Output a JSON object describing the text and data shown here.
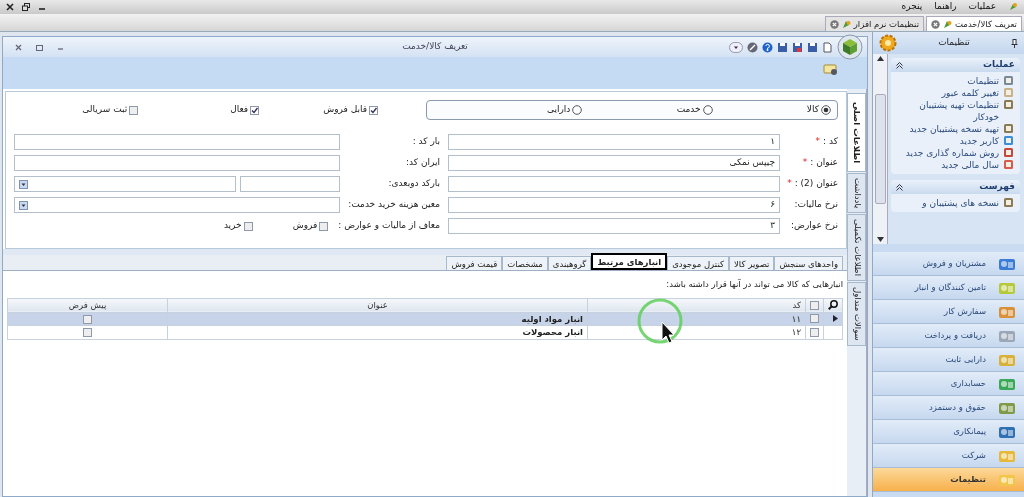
{
  "menu_bar": {
    "items": [
      "عملیات",
      "راهنما",
      "پنجره"
    ]
  },
  "document_tabs": [
    {
      "label": "تعریف کالا/خدمت",
      "selected": true
    },
    {
      "label": "تنظیمات نرم افزار",
      "selected": false
    }
  ],
  "window": {
    "title": "تعریف کالا/خدمت"
  },
  "side_tabs": [
    {
      "label": "اطلاعات اصلی",
      "selected": true
    },
    {
      "label": "یادداشت",
      "selected": false
    },
    {
      "label": "اطلاعات تکمیلی",
      "selected": false
    },
    {
      "label": "سوالات متداول",
      "selected": false
    }
  ],
  "item_type": [
    {
      "label": "کالا",
      "selected": true
    },
    {
      "label": "خدمت",
      "selected": false
    },
    {
      "label": "دارایی",
      "selected": false
    }
  ],
  "flags": [
    {
      "label": "قابل فروش",
      "checked": true
    },
    {
      "label": "فعال",
      "checked": true
    },
    {
      "label": "ثبت سریالی",
      "checked": false
    }
  ],
  "fields_right": [
    {
      "label": "کد :",
      "required_mark": "*",
      "value": "۱"
    },
    {
      "label": "عنوان :",
      "required_mark": "*",
      "value": "چیپس نمکی"
    },
    {
      "label": "عنوان (2) :",
      "required_mark": "*"
    },
    {
      "label": "نرخ مالیات:",
      "value": "۶"
    },
    {
      "label": "نرخ عوارض:",
      "value": "۳"
    }
  ],
  "fields_left": [
    {
      "label": "بار کد :",
      "kind": "text"
    },
    {
      "label": "ایران کد:",
      "kind": "text"
    },
    {
      "label": "بارکد دوبعدی:",
      "kind": "split"
    },
    {
      "label": "معین هزینه خرید خدمت:",
      "kind": "dropdown"
    }
  ],
  "exemption": {
    "label": "معاف از مالیات و عوارض :",
    "options": [
      {
        "label": "فروش",
        "checked": false
      },
      {
        "label": "خرید",
        "checked": false
      }
    ]
  },
  "detail_tabs": [
    {
      "label": "واحدهای سنجش",
      "selected": false
    },
    {
      "label": "تصویر کالا",
      "selected": false
    },
    {
      "label": "کنترل موجودی",
      "selected": false
    },
    {
      "label": "انبارهای مرتبط",
      "selected": true
    },
    {
      "label": "گروهبندی",
      "selected": false
    },
    {
      "label": "مشخصات",
      "selected": false
    },
    {
      "label": "قیمت فروش",
      "selected": false
    }
  ],
  "warehouses": {
    "caption": "انبارهایی که کالا می تواند در آنها قرار داشته باشد:",
    "select_all": false,
    "columns": [
      "کد",
      "عنوان",
      "پیش فرض"
    ],
    "rows": [
      {
        "code": "۱۱",
        "title": "انبار مواد اولیه",
        "checked": false,
        "default": false,
        "selected": true
      },
      {
        "code": "۱۲",
        "title": "انبار محصولات",
        "checked": false,
        "default": false,
        "selected": false
      }
    ]
  },
  "sidebar": {
    "title": "تنظیمات",
    "sections": [
      {
        "title": "عملیات",
        "items": [
          "تنظیمات",
          "تغییر کلمه عبور",
          "تنظیمات تهیه پشتیبان خودکار",
          "تهیه نسخه پشتیبان جدید",
          "کاربر جدید",
          "روش شماره گذاری جدید",
          "سال مالی جدید"
        ]
      },
      {
        "title": "فهرست",
        "items": [
          "نسخه های پشتیبان و"
        ]
      }
    ],
    "modules": [
      {
        "label": "مشتریان و فروش",
        "selected": false
      },
      {
        "label": "تامین کنندگان و انبار",
        "selected": false
      },
      {
        "label": "سفارش کار",
        "selected": false
      },
      {
        "label": "دریافت و پرداخت",
        "selected": false
      },
      {
        "label": "دارایی ثابت",
        "selected": false
      },
      {
        "label": "حسابداری",
        "selected": false
      },
      {
        "label": "حقوق و دستمزد",
        "selected": false
      },
      {
        "label": "پیمانکاری",
        "selected": false
      },
      {
        "label": "شرکت",
        "selected": false
      },
      {
        "label": "تنظیمات",
        "selected": true
      }
    ]
  }
}
